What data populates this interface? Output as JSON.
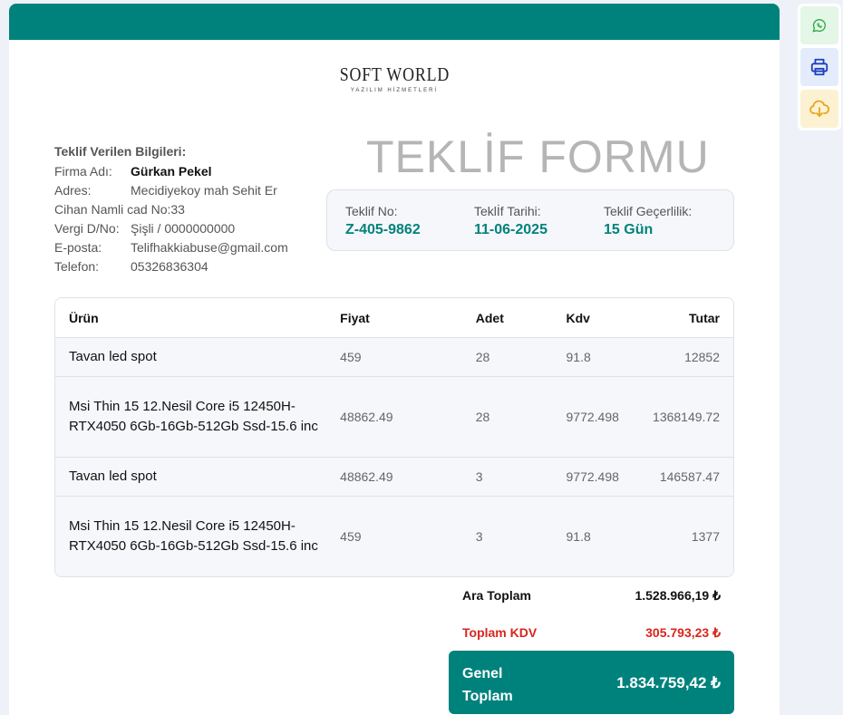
{
  "logo": {
    "main": "SOFT WORLD",
    "sub": "YAZILIM HİZMETLERİ"
  },
  "form_title": "TEKLİF FORMU",
  "customer": {
    "section_title": "Teklif Verilen Bilgileri:",
    "firma_label": "Firma Adı:",
    "firma_value": "Gürkan Pekel",
    "adres_label": "Adres:",
    "adres_value_1": "Mecidiyekoy mah Sehit Er",
    "adres_value_2": "Cihan Namli cad No:33",
    "vergi_label": "Vergi D/No:",
    "vergi_value": "Şişli / 0000000000",
    "eposta_label": "E-posta:",
    "eposta_value": "Telifhakkiabuse@gmail.com",
    "telefon_label": "Telefon:",
    "telefon_value": "05326836304"
  },
  "meta": {
    "no_label": "Teklif No:",
    "no_value": "Z-405-9862",
    "date_label": "Teklİf Tarihi:",
    "date_value": "11-06-2025",
    "validity_label": "Teklif Geçerlilik:",
    "validity_value": "15 Gün"
  },
  "table": {
    "headers": {
      "name": "Ürün",
      "price": "Fiyat",
      "qty": "Adet",
      "kdv": "Kdv",
      "total": "Tutar"
    },
    "rows": [
      {
        "name": "Tavan led spot",
        "price": "459",
        "qty": "28",
        "kdv": "91.8",
        "total": "12852"
      },
      {
        "name": "Msi Thin 15 12.Nesil Core i5 12450H-RTX4050 6Gb-16Gb-512Gb Ssd-15.6 inc",
        "price": "48862.49",
        "qty": "28",
        "kdv": "9772.498",
        "total": "1368149.72"
      },
      {
        "name": "Tavan led spot",
        "price": "48862.49",
        "qty": "3",
        "kdv": "9772.498",
        "total": "146587.47"
      },
      {
        "name": "Msi Thin 15 12.Nesil Core i5 12450H-RTX4050 6Gb-16Gb-512Gb Ssd-15.6 inc",
        "price": "459",
        "qty": "3",
        "kdv": "91.8",
        "total": "1377"
      }
    ]
  },
  "totals": {
    "subtotal_label": "Ara Toplam",
    "subtotal_value": "1.528.966,19 ₺",
    "kdv_label": "Toplam KDV",
    "kdv_value": "305.793,23 ₺",
    "grand_label": "Genel Toplam",
    "grand_value": "1.834.759,42 ₺"
  },
  "side_actions": {
    "whatsapp_icon": "whatsapp-icon",
    "print_icon": "printer-icon",
    "download_icon": "cloud-download-icon"
  },
  "colors": {
    "brand": "#00827c",
    "kdv_red": "#d9251c",
    "title_gray": "#b5b5b5"
  }
}
